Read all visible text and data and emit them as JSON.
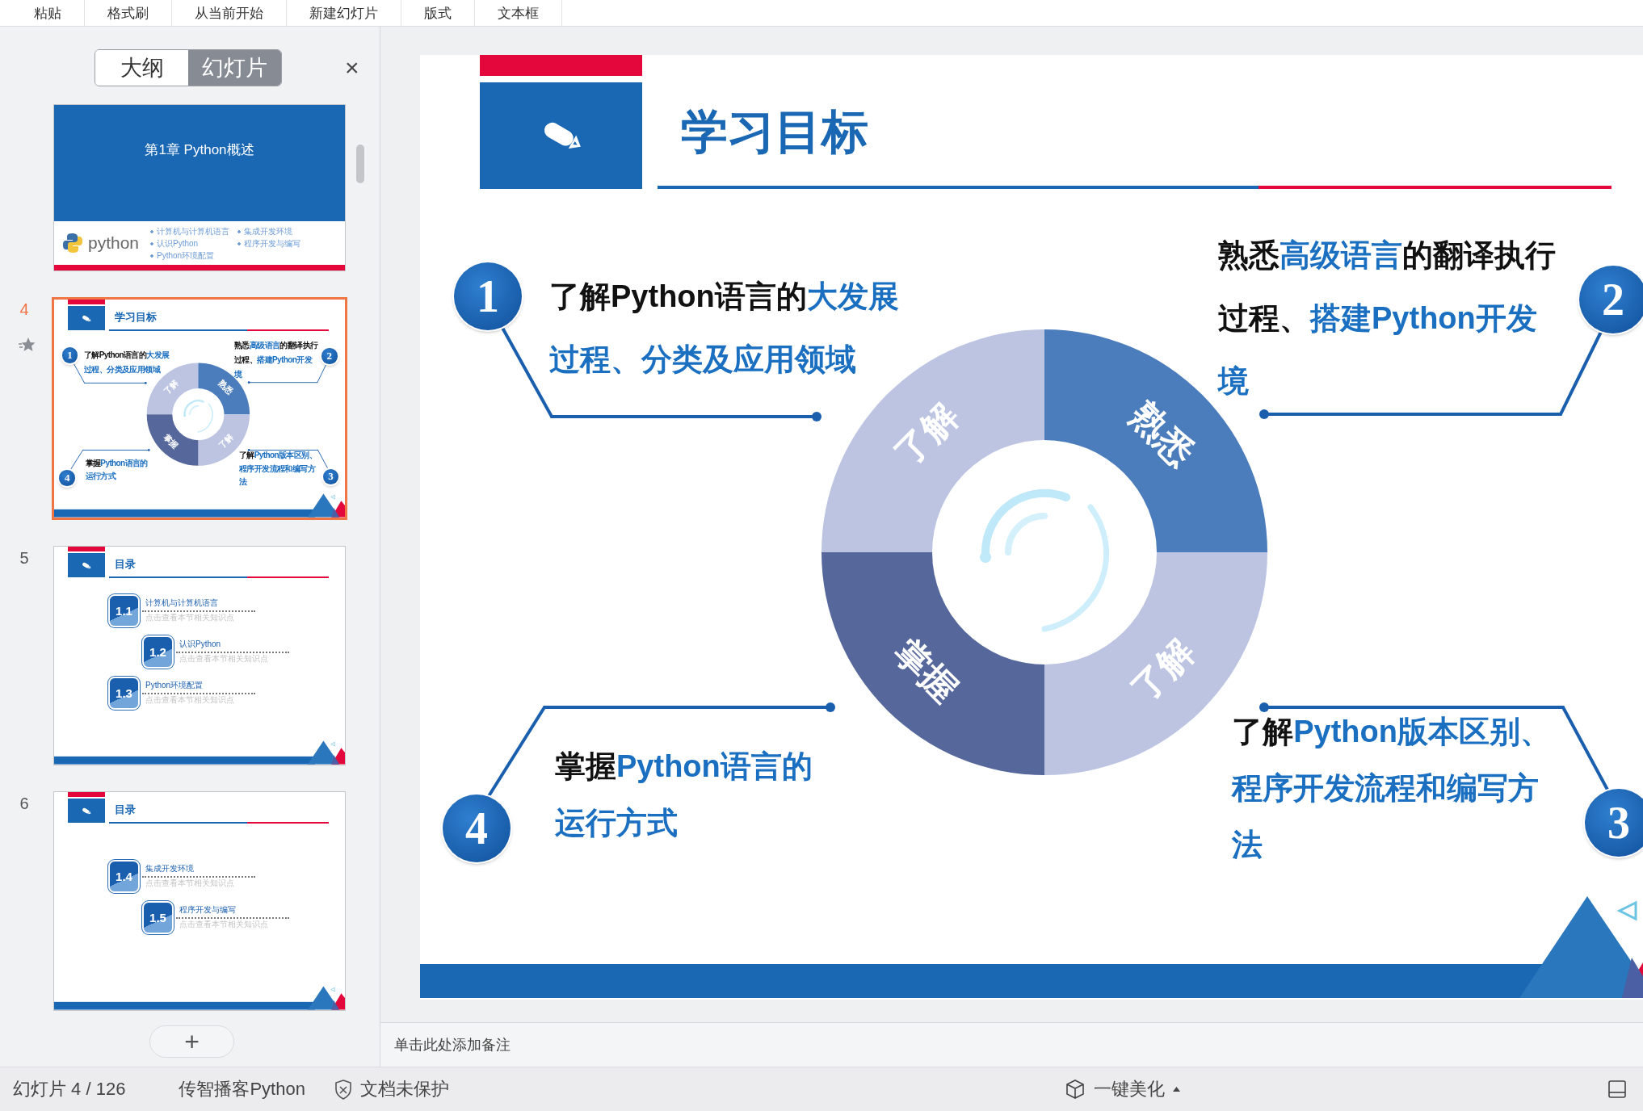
{
  "toolbar": {
    "items": [
      {
        "label": "粘贴"
      },
      {
        "label": "格式刷"
      },
      {
        "label": "从当前开始"
      },
      {
        "label": "新建幻灯片"
      },
      {
        "label": "版式"
      },
      {
        "label": "文本框"
      }
    ]
  },
  "side_panel": {
    "tabs": [
      {
        "label": "大纲",
        "selected": false
      },
      {
        "label": "幻灯片",
        "selected": true
      }
    ],
    "close": "×",
    "slides": [
      {
        "selected": false,
        "content": {
          "kind": "cover",
          "title": "第1章 Python概述",
          "logo_text": "python",
          "bullets": [
            "计算机与计算机语言",
            "认识Python",
            "Python环境配置",
            "集成开发环境",
            "程序开发与编写"
          ]
        }
      },
      {
        "number": "4",
        "selected": true,
        "animated": true,
        "content": {
          "kind": "objectives",
          "title": "学习目标",
          "ring": [
            {
              "label": "了解",
              "color": "#bcc4e2"
            },
            {
              "label": "熟悉",
              "color": "#4b7cbb"
            },
            {
              "label": "了解",
              "color": "#bcc4e2"
            },
            {
              "label": "掌握",
              "color": "#56679c"
            }
          ],
          "items": [
            {
              "number": "1",
              "lines": [
                [
                  {
                    "text": "了解Python语言的",
                    "highlight": false
                  },
                  {
                    "text": "大发展",
                    "highlight": true
                  }
                ],
                [
                  {
                    "text": "过程、分类及应用领域",
                    "highlight": true
                  }
                ]
              ]
            },
            {
              "number": "2",
              "lines": [
                [
                  {
                    "text": "熟悉",
                    "highlight": false
                  },
                  {
                    "text": "高级语言",
                    "highlight": true
                  },
                  {
                    "text": "的翻译执行",
                    "highlight": false
                  }
                ],
                [
                  {
                    "text": "过程、",
                    "highlight": false
                  },
                  {
                    "text": "搭建Python开发",
                    "highlight": true
                  }
                ],
                [
                  {
                    "text": "境",
                    "highlight": true
                  }
                ]
              ]
            },
            {
              "number": "4",
              "lines": [
                [
                  {
                    "text": "掌握",
                    "highlight": false
                  },
                  {
                    "text": "Python语言的",
                    "highlight": true
                  }
                ],
                [
                  {
                    "text": "运行方式",
                    "highlight": true
                  }
                ]
              ]
            },
            {
              "number": "3",
              "lines": [
                [
                  {
                    "text": "了解",
                    "highlight": false
                  },
                  {
                    "text": "Python版本区别、",
                    "highlight": true
                  }
                ],
                [
                  {
                    "text": "程序开发流程和编写方",
                    "highlight": true
                  }
                ],
                [
                  {
                    "text": "法",
                    "highlight": true
                  }
                ]
              ]
            }
          ]
        }
      },
      {
        "number": "5",
        "selected": false,
        "content": {
          "kind": "toc",
          "title": "目录",
          "entries": [
            {
              "number": "1.1",
              "title": "计算机与计算机语言",
              "hint": "点击查看本节相关知识点"
            },
            {
              "number": "1.2",
              "title": "认识Python",
              "hint": "点击查看本节相关知识点"
            },
            {
              "number": "1.3",
              "title": "Python环境配置",
              "hint": "点击查看本节相关知识点"
            }
          ]
        }
      },
      {
        "number": "6",
        "selected": false,
        "content": {
          "kind": "toc",
          "title": "目录",
          "entries": [
            {
              "number": "1.4",
              "title": "集成开发环境",
              "hint": "点击查看本节相关知识点"
            },
            {
              "number": "1.5",
              "title": "程序开发与编写",
              "hint": "点击查看本节相关知识点"
            }
          ]
        }
      }
    ],
    "add_button": "+"
  },
  "slide": {
    "kind": "objectives",
    "title": "学习目标",
    "ring": [
      {
        "label": "了解",
        "color": "#bcc4e2"
      },
      {
        "label": "熟悉",
        "color": "#4b7cbb"
      },
      {
        "label": "了解",
        "color": "#bcc4e2"
      },
      {
        "label": "掌握",
        "color": "#56679c"
      }
    ],
    "items": [
      {
        "number": "1",
        "lines": [
          [
            {
              "text": "了解Python语言的",
              "highlight": false
            },
            {
              "text": "大发展",
              "highlight": true
            }
          ],
          [
            {
              "text": "过程、分类及应用领域",
              "highlight": true
            }
          ]
        ]
      },
      {
        "number": "2",
        "lines": [
          [
            {
              "text": "熟悉",
              "highlight": false
            },
            {
              "text": "高级语言",
              "highlight": true
            },
            {
              "text": "的翻译执行",
              "highlight": false
            }
          ],
          [
            {
              "text": "过程、",
              "highlight": false
            },
            {
              "text": "搭建Python开发",
              "highlight": true
            }
          ],
          [
            {
              "text": "境",
              "highlight": true
            }
          ]
        ]
      },
      {
        "number": "4",
        "lines": [
          [
            {
              "text": "掌握",
              "highlight": false
            },
            {
              "text": "Python语言的",
              "highlight": true
            }
          ],
          [
            {
              "text": "运行方式",
              "highlight": true
            }
          ]
        ]
      },
      {
        "number": "3",
        "lines": [
          [
            {
              "text": "了解",
              "highlight": false
            },
            {
              "text": "Python版本区别、",
              "highlight": true
            }
          ],
          [
            {
              "text": "程序开发流程和编写方",
              "highlight": true
            }
          ],
          [
            {
              "text": "法",
              "highlight": true
            }
          ]
        ]
      }
    ]
  },
  "notes": {
    "placeholder": "单击此处添加备注"
  },
  "status_bar": {
    "slide_counter": "幻灯片 4 / 126",
    "author": "传智播客Python",
    "protection": "文档未保护",
    "beautify": "一键美化"
  }
}
